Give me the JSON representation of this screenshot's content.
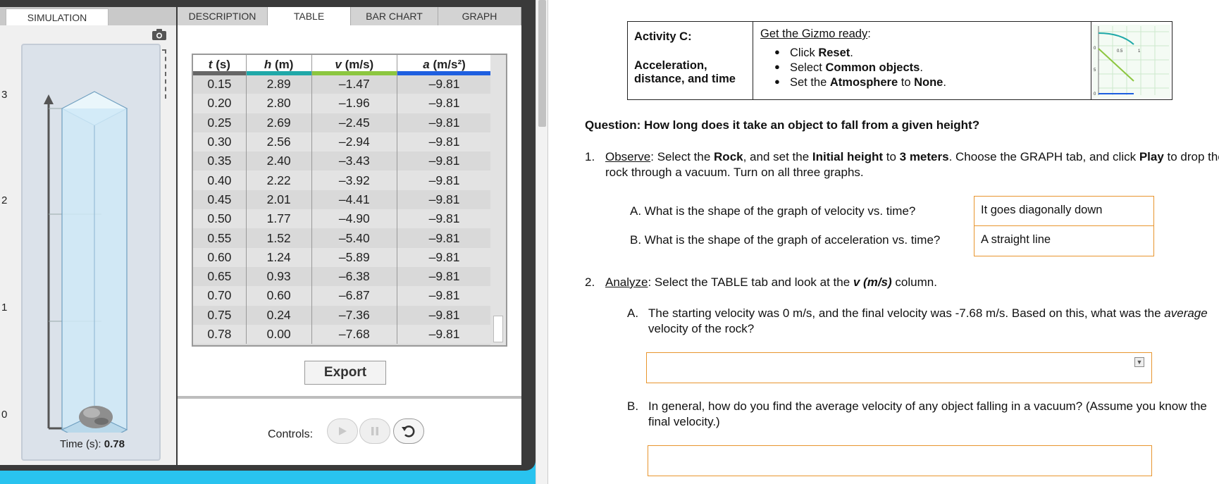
{
  "gizmo": {
    "tabs": {
      "simulation": "SIMULATION",
      "description": "DESCRIPTION",
      "table": "TABLE",
      "bar_chart": "BAR CHART",
      "graph": "GRAPH"
    },
    "active_tab": "TABLE",
    "tube_axis_labels": [
      "3",
      "2",
      "1",
      "0"
    ],
    "time_label": "Time (s): ",
    "time_value": "0.78",
    "table": {
      "headers": [
        {
          "var": "t",
          "unit": " (s)",
          "color": "#666666"
        },
        {
          "var": "h",
          "unit": " (m)",
          "color": "#1fa8a8"
        },
        {
          "var": "v",
          "unit": " (m/s)",
          "color": "#8cc63f"
        },
        {
          "var": "a",
          "unit": " (m/s²)",
          "color": "#1e5fe0"
        }
      ],
      "rows": [
        [
          "0.15",
          "2.89",
          "–1.47",
          "–9.81"
        ],
        [
          "0.20",
          "2.80",
          "–1.96",
          "–9.81"
        ],
        [
          "0.25",
          "2.69",
          "–2.45",
          "–9.81"
        ],
        [
          "0.30",
          "2.56",
          "–2.94",
          "–9.81"
        ],
        [
          "0.35",
          "2.40",
          "–3.43",
          "–9.81"
        ],
        [
          "0.40",
          "2.22",
          "–3.92",
          "–9.81"
        ],
        [
          "0.45",
          "2.01",
          "–4.41",
          "–9.81"
        ],
        [
          "0.50",
          "1.77",
          "–4.90",
          "–9.81"
        ],
        [
          "0.55",
          "1.52",
          "–5.40",
          "–9.81"
        ],
        [
          "0.60",
          "1.24",
          "–5.89",
          "–9.81"
        ],
        [
          "0.65",
          "0.93",
          "–6.38",
          "–9.81"
        ],
        [
          "0.70",
          "0.60",
          "–6.87",
          "–9.81"
        ],
        [
          "0.75",
          "0.24",
          "–7.36",
          "–9.81"
        ],
        [
          "0.78",
          "0.00",
          "–7.68",
          "–9.81"
        ]
      ]
    },
    "export_label": "Export",
    "controls_label": "Controls:"
  },
  "doc": {
    "activity": {
      "title": "Activity C:",
      "subtitle": "Acceleration, distance, and time",
      "ready": "Get the Gizmo ready",
      "ready_colon": ":",
      "steps": [
        {
          "pre": "Click ",
          "bold": "Reset",
          "post": "."
        },
        {
          "pre": "Select ",
          "bold": "Common objects",
          "post": "."
        },
        {
          "pre": "Set the ",
          "bold": "Atmosphere",
          "mid": " to ",
          "bold2": "None",
          "post": "."
        }
      ],
      "mini_graph_ticks": [
        "0",
        "0.5",
        "1",
        "5",
        "0"
      ]
    },
    "question": "Question: How long does it take an object to fall from a given height?",
    "item1": {
      "num": "1.",
      "label": "Observe",
      "p1": ": Select the ",
      "b1": "Rock",
      "p2": ", and set the ",
      "b2": "Initial height",
      "p3": " to ",
      "b3": "3 meters",
      "p4": ". Choose the GRAPH tab, and click ",
      "b4": "Play",
      "p5": " to drop the rock through a vacuum. Turn on all three graphs."
    },
    "qaA": {
      "q": "A. What is the shape of the graph of velocity vs. time?",
      "a": "It goes diagonally down"
    },
    "qaB": {
      "q": "B. What is the shape of the graph of acceleration vs. time?",
      "a": "A straight line"
    },
    "item2": {
      "num": "2.",
      "label": "Analyze",
      "p1": ": Select the TABLE tab and look at the ",
      "b1": "v (m/s)",
      "p2": " column."
    },
    "subA": {
      "letter": "A.",
      "p1": "The starting velocity was 0 m/s, and the final velocity was -7.68 m/s. Based on this, what was the ",
      "em": "average",
      "p2": " velocity of the rock?"
    },
    "subB": {
      "letter": "B.",
      "text": "In general, how do you find the average velocity of any object falling in a vacuum? (Assume you know the final velocity.)"
    },
    "answer_box_accent": "#e8952e"
  }
}
